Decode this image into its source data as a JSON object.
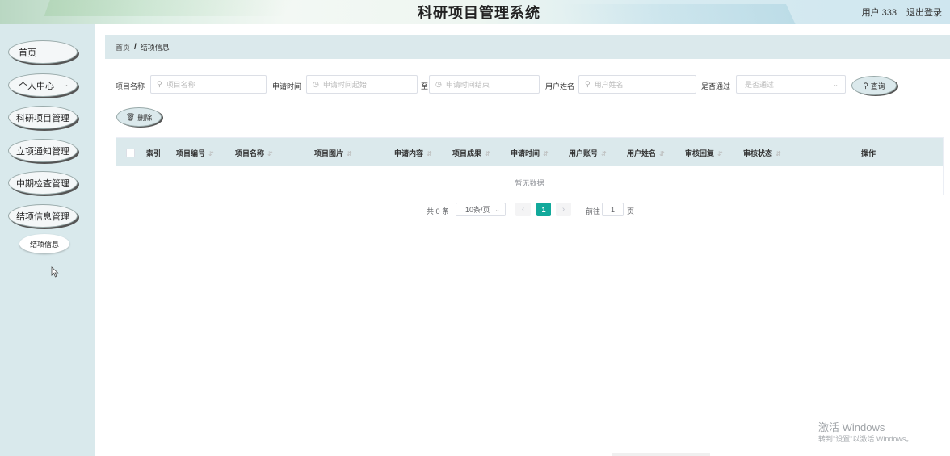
{
  "header": {
    "title": "科研项目管理系统",
    "user": "用户 333",
    "logout": "退出登录"
  },
  "sidebar": {
    "items": [
      {
        "label": "首页"
      },
      {
        "label": "个人中心"
      },
      {
        "label": "科研项目管理"
      },
      {
        "label": "立项通知管理"
      },
      {
        "label": "中期检查管理"
      },
      {
        "label": "结项信息管理"
      }
    ],
    "subitem": "结项信息"
  },
  "breadcrumb": {
    "home": "首页",
    "separator": "/",
    "current": "结项信息"
  },
  "search": {
    "project_name_label": "项目名称",
    "project_name_placeholder": "项目名称",
    "apply_time_label": "申请时间",
    "apply_time_start_placeholder": "申请时间起始",
    "to_label": "至",
    "apply_time_end_placeholder": "申请时间结束",
    "user_name_label": "用户姓名",
    "user_name_placeholder": "用户姓名",
    "passed_label": "是否通过",
    "passed_placeholder": "是否通过",
    "query_button": "查询"
  },
  "actions": {
    "delete_button": "删除"
  },
  "table": {
    "columns": [
      "索引",
      "项目编号",
      "项目名称",
      "项目图片",
      "申请内容",
      "项目成果",
      "申请时间",
      "用户账号",
      "用户姓名",
      "审核回复",
      "审核状态",
      "操作"
    ],
    "empty_text": "暂无数据"
  },
  "pagination": {
    "total": "共 0 条",
    "page_size": "10条/页",
    "current_page": "1",
    "goto_label": "前往",
    "goto_value": "1",
    "page_suffix": "页"
  },
  "watermark": {
    "line1": "激活 Windows",
    "line2": "转到\"设置\"以激活 Windows。"
  },
  "colors": {
    "accent": "#12a99b",
    "sidebar_bg": "#d9e9ec",
    "table_header_bg": "#dbe9ec"
  }
}
